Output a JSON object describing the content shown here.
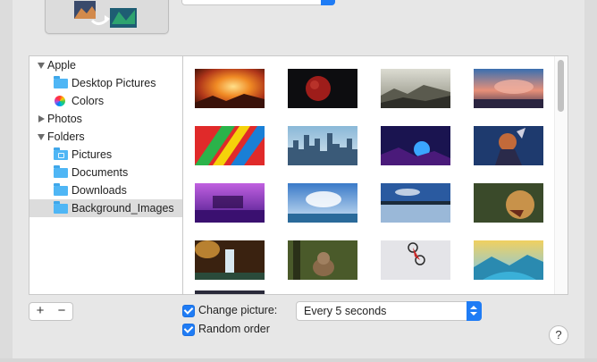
{
  "sidebar": {
    "groups": [
      {
        "label": "Apple",
        "expanded": true,
        "items": [
          {
            "label": "Desktop Pictures",
            "icon": "folder-icon"
          },
          {
            "label": "Colors",
            "icon": "color-wheel-icon"
          }
        ]
      },
      {
        "label": "Photos",
        "expanded": false,
        "items": []
      },
      {
        "label": "Folders",
        "expanded": true,
        "items": [
          {
            "label": "Pictures",
            "icon": "camera-folder-icon"
          },
          {
            "label": "Documents",
            "icon": "folder-icon"
          },
          {
            "label": "Downloads",
            "icon": "folder-icon"
          },
          {
            "label": "Background_Images",
            "icon": "folder-icon",
            "selected": true
          }
        ]
      }
    ]
  },
  "controls": {
    "add_label": "+",
    "remove_label": "−",
    "change_picture_label": "Change picture:",
    "change_picture_checked": true,
    "interval_value": "Every 5 seconds",
    "random_order_label": "Random order",
    "random_order_checked": true,
    "help_label": "?"
  },
  "thumbnails": [
    "orange-nebula",
    "red-moon",
    "misty-mountains",
    "sunset-clouds",
    "colorful-feathers",
    "city-skyline",
    "neon-sunset",
    "fantasy-warrior",
    "purple-lake",
    "sky-sea",
    "lake-reflection",
    "roaring-lion",
    "waterfall-forest",
    "cat-forest",
    "bike-rider",
    "fantasy-valley"
  ],
  "colors": {
    "accent": "#1f7cf5",
    "selection": "#dcdcdc",
    "folder": "#4fb6f5"
  }
}
